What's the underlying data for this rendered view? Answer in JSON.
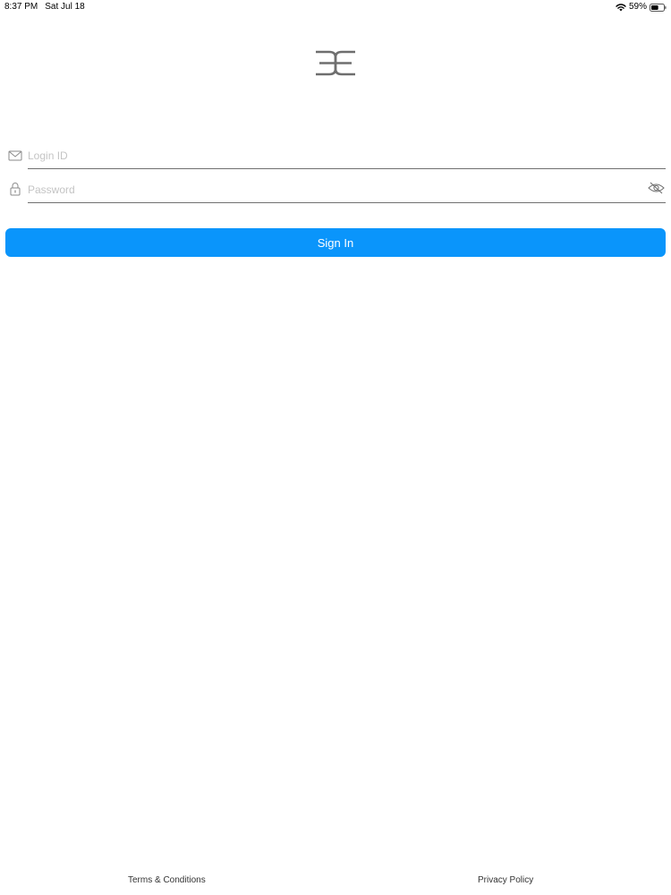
{
  "status_bar": {
    "time": "8:37 PM",
    "date": "Sat Jul 18",
    "battery_percent": "59%",
    "battery_level": 0.59,
    "icons": [
      "wifi-icon",
      "battery-icon"
    ]
  },
  "logo": {
    "icon": "brand-logo"
  },
  "login_form": {
    "login_id": {
      "placeholder": "Login ID",
      "value": "",
      "icon": "mail-icon"
    },
    "password": {
      "placeholder": "Password",
      "value": "",
      "icon": "lock-icon",
      "toggle_icon": "eye-slash-icon"
    },
    "sign_in_label": "Sign In"
  },
  "footer": {
    "terms_label": "Terms & Conditions",
    "privacy_label": "Privacy Policy"
  },
  "colors": {
    "accent": "#0a95fb",
    "underline": "#707070",
    "placeholder": "#c4c4c4"
  }
}
